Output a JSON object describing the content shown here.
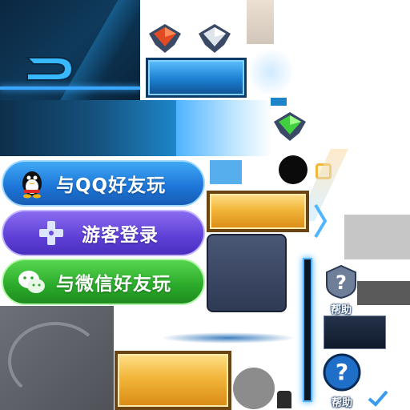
{
  "login_buttons": {
    "qq_label": "与QQ好友玩",
    "guest_label": "游客登录",
    "wechat_label": "与微信好友玩"
  },
  "help": {
    "small_label": "帮助",
    "large_label": "帮助"
  },
  "icons": {
    "qq": "qq-penguin-icon",
    "guest": "gamepad-icon",
    "wechat": "wechat-icon",
    "gem_red": "red-gem-icon",
    "gem_white": "white-gem-icon",
    "gem_green": "green-gem-icon",
    "help": "help-question-icon",
    "check": "checkmark-icon"
  },
  "colors": {
    "qq_button": "#2a86e6",
    "guest_button": "#6a4be0",
    "wechat_button": "#33b533",
    "gold_button": "#f2b63a",
    "panel_blue": "#0f3a5c"
  }
}
